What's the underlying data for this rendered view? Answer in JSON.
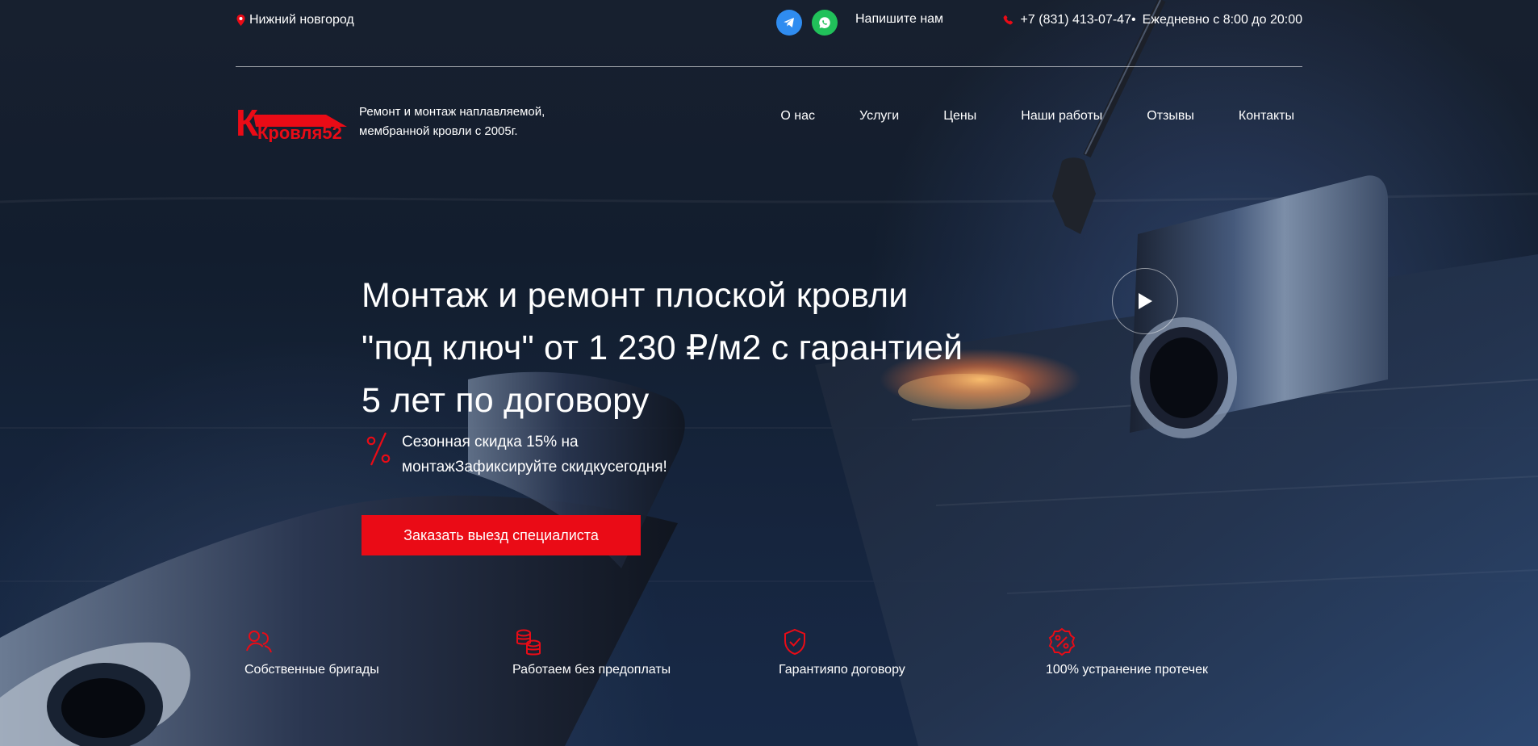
{
  "topbar": {
    "city": "Нижний новгород",
    "message_label": "Напишите нам",
    "phone": "+7 (831) 413-07-47•",
    "hours": "Ежедневно с 8:00 до 20:00"
  },
  "branding": {
    "logo_text": "Кровля52",
    "tagline": "Ремонт и монтаж наплавляемой, мембранной кровли с 2005г."
  },
  "nav": {
    "items": [
      {
        "label": "О нас"
      },
      {
        "label": "Услуги"
      },
      {
        "label": "Цены"
      },
      {
        "label": "Наши работы"
      },
      {
        "label": "Отзывы"
      },
      {
        "label": "Контакты"
      }
    ]
  },
  "hero": {
    "title_line_1": "Монтаж и ремонт плоской кровли",
    "title_line_2": "\"под ключ\" от 1 230 ₽/м2 с гарантией",
    "title_line_3": "5 лет по договору",
    "promo_text": "Сезонная скидка 15% на монтажЗафиксируйте скидкусегодня!",
    "cta_label": "Заказать выезд специалиста"
  },
  "features": {
    "items": [
      {
        "label": "Собственные бригады",
        "icon": "people-icon"
      },
      {
        "label": "Работаем без предоплаты",
        "icon": "coins-icon"
      },
      {
        "label": "Гарантияпо договору",
        "icon": "shield-check-icon"
      },
      {
        "label": "100% устранение протечек",
        "icon": "percent-badge-icon"
      }
    ]
  },
  "colors": {
    "accent": "#ea0b16",
    "text": "#ffffff",
    "telegram": "#2f8cf0",
    "whatsapp": "#21c15a"
  }
}
